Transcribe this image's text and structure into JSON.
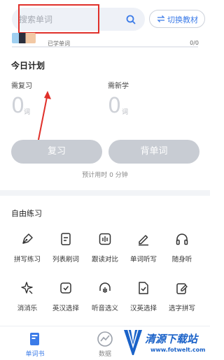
{
  "search": {
    "placeholder": "搜索单词"
  },
  "switch_book": {
    "label": "切换教材"
  },
  "book": {
    "learned_label": "已学单词",
    "learned_count": "0/0",
    "progress_fraction": 0
  },
  "plan": {
    "title": "今日计划",
    "review_label": "需复习",
    "review_count": "0",
    "review_unit": "词",
    "new_label": "需新学",
    "new_count": "0",
    "new_unit": "词",
    "review_button": "复习",
    "learn_button": "背单词",
    "estimate": "预计用时 0 分钟"
  },
  "practice": {
    "title": "自由练习",
    "items": [
      {
        "label": "拼写练习",
        "icon": "pen-nib-icon"
      },
      {
        "label": "列表刷词",
        "icon": "list-icon"
      },
      {
        "label": "跟读对比",
        "icon": "audio-bars-icon"
      },
      {
        "label": "单词听写",
        "icon": "pencil-icon"
      },
      {
        "label": "随身听",
        "icon": "headphones-icon"
      },
      {
        "label": "消消乐",
        "icon": "sparkle-icon"
      },
      {
        "label": "英汉选择",
        "icon": "check-card-icon"
      },
      {
        "label": "听音选义",
        "icon": "headphone-bars-icon"
      },
      {
        "label": "汉英选择",
        "icon": "check-doc-icon"
      },
      {
        "label": "选字拼写",
        "icon": "edit-doc-icon"
      }
    ]
  },
  "tabs": [
    {
      "label": "单词书",
      "icon": "book-icon",
      "active": true
    },
    {
      "label": "数据",
      "icon": "chart-icon",
      "active": false
    }
  ],
  "watermark": {
    "title": "清源下载站",
    "url": "www.fotwelt.com"
  },
  "colors": {
    "accent": "#3b7be8",
    "button_disabled": "#c8ccd3",
    "annotation": "#e0302a"
  }
}
